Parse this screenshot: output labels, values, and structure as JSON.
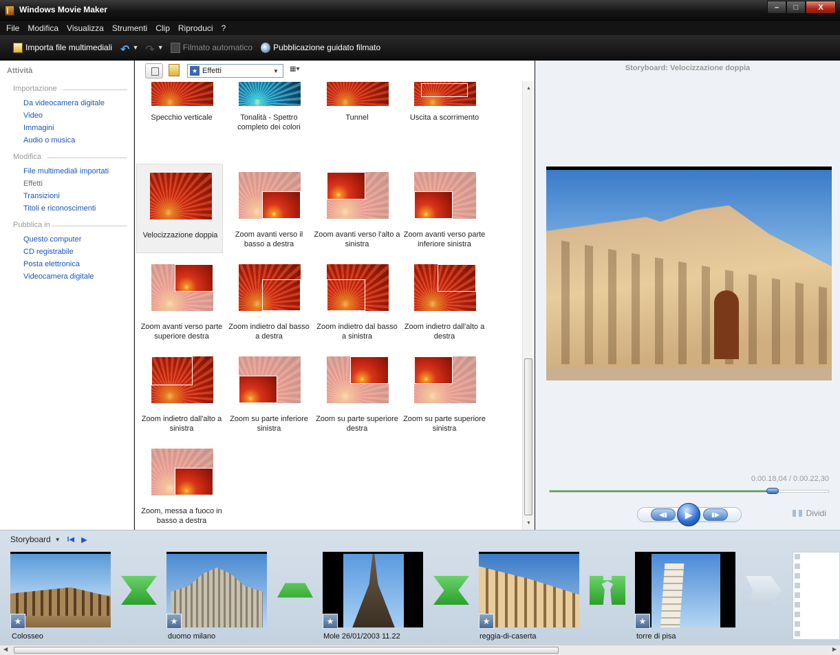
{
  "window": {
    "title": "Windows Movie Maker",
    "minimize": "–",
    "maximize": "□",
    "close": "X"
  },
  "menu": [
    "File",
    "Modifica",
    "Visualizza",
    "Strumenti",
    "Clip",
    "Riproduci",
    "?"
  ],
  "toolbar": {
    "import_label": "Importa file multimediali",
    "undo_icon": "↶",
    "redo_icon": "↷",
    "dropdown": "▼",
    "automovie_label": "Filmato automatico",
    "publish_label": "Pubblicazione guidato filmato"
  },
  "tasks": {
    "title": "Attività",
    "sections": [
      {
        "label": "Importazione",
        "items": [
          "Da videocamera digitale",
          "Video",
          "Immagini",
          "Audio o musica"
        ]
      },
      {
        "label": "Modifica",
        "items": [
          "File multimediali importati",
          "Effetti",
          "Transizioni",
          "Titoli e riconoscimenti"
        ]
      },
      {
        "label": "Pubblica in",
        "items": [
          "Questo computer",
          "CD registrabile",
          "Posta elettronica",
          "Videocamera digitale"
        ]
      }
    ]
  },
  "collection": {
    "selected": "Effetti",
    "effects": [
      "Specchio verticale",
      "Tonalità - Spettro completo dei colori",
      "Tunnel",
      "Uscita a scorrimento",
      "Velocizzazione doppia",
      "Zoom avanti verso il basso a destra",
      "Zoom avanti verso l'alto a sinistra",
      "Zoom avanti verso parte inferiore sinistra",
      "Zoom avanti verso parte superiore destra",
      "Zoom indietro dal basso a destra",
      "Zoom indietro dal basso a sinistra",
      "Zoom indietro dall'alto a destra",
      "Zoom indietro dall'alto a sinistra",
      "Zoom su parte inferiore sinistra",
      "Zoom su parte superiore destra",
      "Zoom su parte superiore sinistra",
      "Zoom, messa a fuoco in basso a destra"
    ],
    "selected_effect": "Velocizzazione doppia"
  },
  "preview": {
    "title": "Storyboard: Velocizzazione doppia",
    "time": "0.00.18,04 / 0.00.22,30",
    "progress": 0.8,
    "prev_icon": "◀▮",
    "play_icon": "▶",
    "next_icon": "▮▶",
    "split_label": "Dividi"
  },
  "storyboard": {
    "title": "Storyboard",
    "clips": [
      "Colosseo",
      "duomo milano",
      "Mole 26/01/2003 11.22",
      "reggia-di-caserta",
      "torre di pisa"
    ],
    "transitions": [
      "hourglass",
      "trapezoid",
      "hourglass",
      "keyhole",
      "empty"
    ]
  },
  "icons": {
    "star": "★",
    "up": "▲",
    "down": "▼",
    "left": "◀",
    "right": "▶",
    "grip": "≡",
    "hgrip": "III"
  }
}
